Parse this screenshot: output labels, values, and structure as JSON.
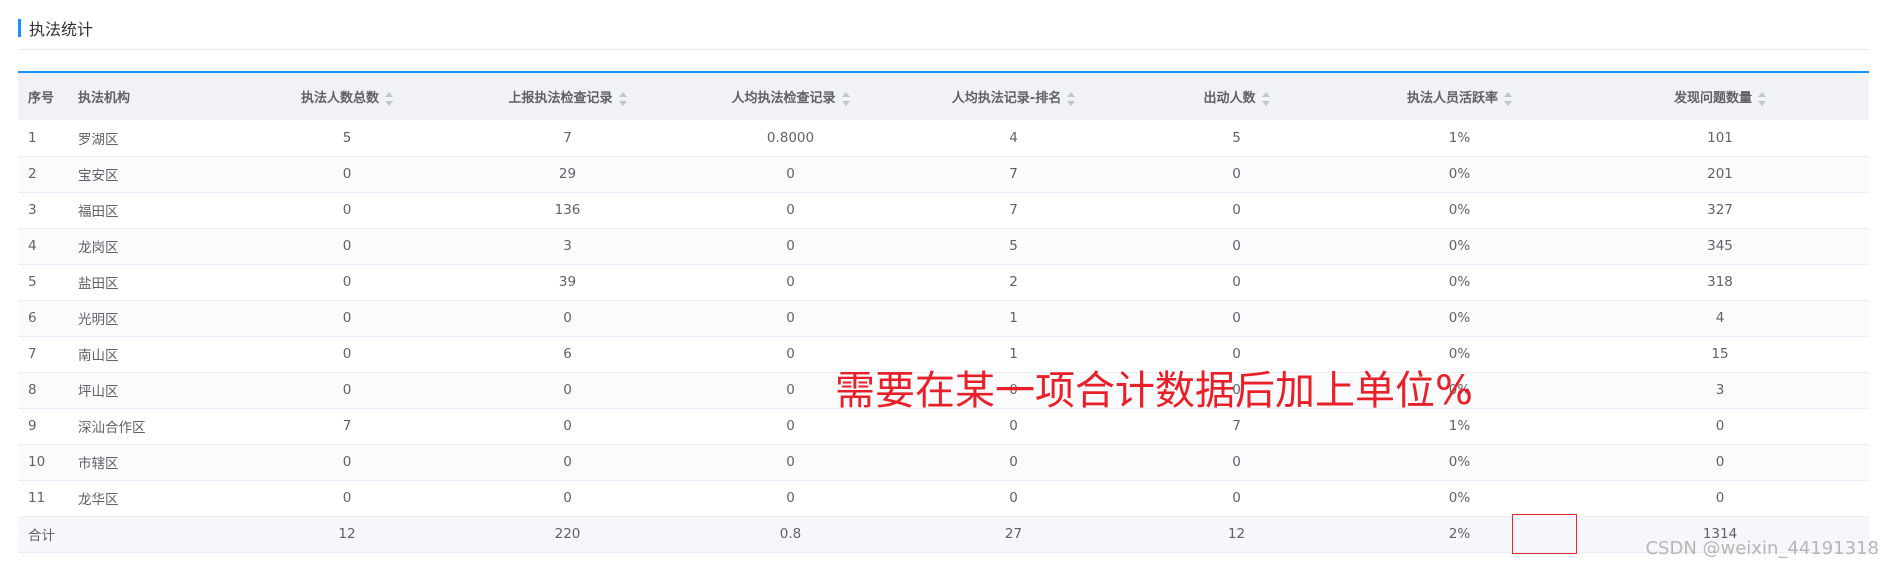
{
  "header": {
    "title": "执法统计"
  },
  "table": {
    "columns": [
      "序号",
      "执法机构",
      "执法人数总数",
      "上报执法检查记录",
      "人均执法检查记录",
      "人均执法记录-排名",
      "出动人数",
      "执法人员活跃率",
      "发现问题数量"
    ],
    "rows": [
      [
        "1",
        "罗湖区",
        "5",
        "7",
        "0.8000",
        "4",
        "5",
        "1%",
        "101"
      ],
      [
        "2",
        "宝安区",
        "0",
        "29",
        "0",
        "7",
        "0",
        "0%",
        "201"
      ],
      [
        "3",
        "福田区",
        "0",
        "136",
        "0",
        "7",
        "0",
        "0%",
        "327"
      ],
      [
        "4",
        "龙岗区",
        "0",
        "3",
        "0",
        "5",
        "0",
        "0%",
        "345"
      ],
      [
        "5",
        "盐田区",
        "0",
        "39",
        "0",
        "2",
        "0",
        "0%",
        "318"
      ],
      [
        "6",
        "光明区",
        "0",
        "0",
        "0",
        "1",
        "0",
        "0%",
        "4"
      ],
      [
        "7",
        "南山区",
        "0",
        "6",
        "0",
        "1",
        "0",
        "0%",
        "15"
      ],
      [
        "8",
        "坪山区",
        "0",
        "0",
        "0",
        "0",
        "0",
        "0%",
        "3"
      ],
      [
        "9",
        "深汕合作区",
        "7",
        "0",
        "0",
        "0",
        "7",
        "1%",
        "0"
      ],
      [
        "10",
        "市辖区",
        "0",
        "0",
        "0",
        "0",
        "0",
        "0%",
        "0"
      ],
      [
        "11",
        "龙华区",
        "0",
        "0",
        "0",
        "0",
        "0",
        "0%",
        "0"
      ]
    ],
    "total": [
      "合计",
      "",
      "12",
      "220",
      "0.8",
      "27",
      "12",
      "2%",
      "1314"
    ]
  },
  "annotation": {
    "text": "需要在某一项合计数据后加上单位%"
  },
  "watermark": {
    "text": "CSDN @weixin_44191318"
  },
  "colors": {
    "accent": "#1890ff",
    "annotation": "#e8202a"
  }
}
